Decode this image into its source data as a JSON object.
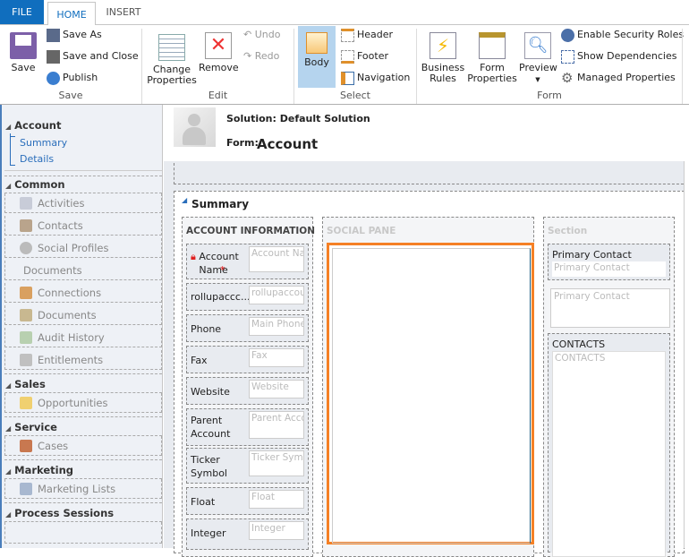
{
  "tabs": {
    "file": "FILE",
    "home": "HOME",
    "insert": "INSERT"
  },
  "ribbon": {
    "save": {
      "save": "Save",
      "save_as": "Save As",
      "save_close": "Save and Close",
      "publish": "Publish",
      "group": "Save"
    },
    "edit": {
      "change_1": "Change",
      "change_2": "Properties",
      "remove": "Remove",
      "undo": "Undo",
      "redo": "Redo",
      "group": "Edit"
    },
    "select": {
      "body": "Body",
      "header": "Header",
      "footer": "Footer",
      "navigation": "Navigation",
      "group": "Select"
    },
    "form": {
      "br_1": "Business",
      "br_2": "Rules",
      "fp_1": "Form",
      "fp_2": "Properties",
      "preview": "Preview",
      "security": "Enable Security Roles",
      "deps": "Show Dependencies",
      "managed": "Managed Properties",
      "group": "Form"
    }
  },
  "sidebar": {
    "account": "Account",
    "summary": "Summary",
    "details": "Details",
    "common": "Common",
    "common_items": [
      "Activities",
      "Contacts",
      "Social Profiles",
      "Documents",
      "Connections",
      "Documents",
      "Audit History",
      "Entitlements"
    ],
    "sales": "Sales",
    "sales_items": [
      "Opportunities"
    ],
    "service": "Service",
    "service_items": [
      "Cases"
    ],
    "marketing": "Marketing",
    "marketing_items": [
      "Marketing Lists"
    ],
    "process": "Process Sessions"
  },
  "header": {
    "solution": "Solution: Default Solution",
    "form_label": "Form:",
    "form_name": "Account"
  },
  "form": {
    "tab_title": "Summary",
    "account_info": "ACCOUNT INFORMATION",
    "fields": [
      {
        "label": "Account Name",
        "placeholder": "Account Name",
        "required": "*"
      },
      {
        "label": "rollupaccc...",
        "placeholder": "rollupaccount"
      },
      {
        "label": "Phone",
        "placeholder": "Main Phone"
      },
      {
        "label": "Fax",
        "placeholder": "Fax"
      },
      {
        "label": "Website",
        "placeholder": "Website"
      },
      {
        "label": "Parent Account",
        "placeholder": "Parent Account"
      },
      {
        "label": "Ticker Symbol",
        "placeholder": "Ticker Symbol"
      },
      {
        "label": "Float",
        "placeholder": "Float"
      },
      {
        "label": "Integer",
        "placeholder": "Integer"
      }
    ],
    "social_pane": "SOCIAL PANE",
    "section": "Section",
    "primary_contact_label": "Primary Contact",
    "primary_contact_placeholder": "Primary Contact",
    "primary_contact_card": "Primary Contact",
    "contacts_label": "CONTACTS",
    "contacts_placeholder": "CONTACTS"
  },
  "colors": {
    "file_tab": "#106ebe",
    "accent": "#f58025",
    "select_bg": "#b5d4ee"
  }
}
